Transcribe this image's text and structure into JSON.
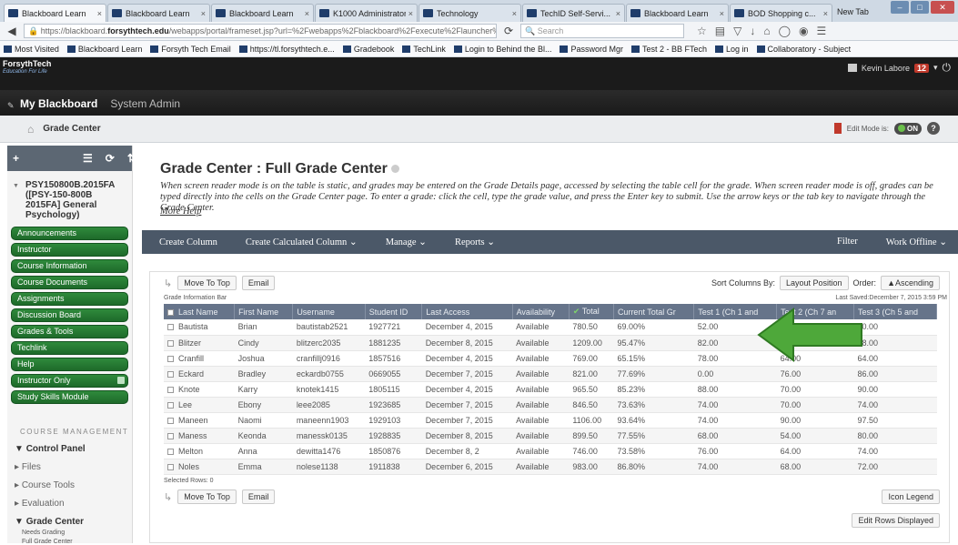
{
  "browser": {
    "tabs": [
      {
        "label": "Blackboard Learn",
        "active": true
      },
      {
        "label": "Blackboard Learn",
        "active": false
      },
      {
        "label": "Blackboard Learn",
        "active": false
      },
      {
        "label": "K1000 Administrator ...",
        "active": false
      },
      {
        "label": "Technology",
        "active": false
      },
      {
        "label": "TechID Self-Servi...",
        "active": false
      },
      {
        "label": "Blackboard Learn",
        "active": false
      },
      {
        "label": "BOD Shopping c...",
        "active": false
      }
    ],
    "new_tab_label": "New Tab",
    "url_prefix": "https://blackboard.",
    "url_host": "forsythtech.edu",
    "url_rest": "/webapps/portal/frameset.jsp?url=%2Fwebapps%2Fblackboard%2Fexecute%2Flauncher%3Ftype%3DCourse%26id%3D_189",
    "search_placeholder": "Search",
    "bookmarks": [
      "Most Visited",
      "Blackboard Learn",
      "Forsyth Tech Email",
      "https://tl.forsythtech.e...",
      "Gradebook",
      "TechLink",
      "Login to Behind the Bl...",
      "Password Mgr",
      "Test 2 - BB FTech",
      "Log in",
      "Collaboratory - Subject"
    ]
  },
  "bb": {
    "logo": "ForsythTech",
    "logo_tag": "Education For Life",
    "user_name": "Kevin Labore",
    "notification_count": "12",
    "tabs": [
      "My Blackboard",
      "System Admin"
    ],
    "breadcrumb": "Grade Center",
    "edit_mode_label": "Edit Mode is:",
    "edit_mode_value": "ON"
  },
  "sidebar": {
    "course_title": "PSY150800B.2015FA ([PSY-150-800B 2015FA] General Psychology)",
    "menu": [
      "Announcements",
      "Instructor",
      "Course Information",
      "Course Documents",
      "Assignments",
      "Discussion Board",
      "Grades & Tools",
      "Techlink",
      "Help",
      "Instructor Only",
      "Study Skills Module"
    ],
    "mgmt_header": "COURSE MANAGEMENT",
    "mgmt_items": [
      "Control Panel",
      "Files",
      "Course Tools",
      "Evaluation",
      "Grade Center"
    ],
    "grade_center_sub": [
      "Needs Grading",
      "Full Grade Center"
    ]
  },
  "main": {
    "title": "Grade Center : Full Grade Center",
    "intro": "When screen reader mode is on the table is static, and grades may be entered on the Grade Details page, accessed by selecting the table cell for the grade. When screen reader mode is off, grades can be typed directly into the cells on the Grade Center page. To enter a grade: click the cell, type the grade value, and press the Enter key to submit. Use the arrow keys or the tab key to navigate through the Grade Center.",
    "more_help": "More Help",
    "actions": [
      "Create Column",
      "Create Calculated Column ⌄",
      "Manage ⌄",
      "Reports ⌄"
    ],
    "actions_right": [
      "Filter",
      "Work Offline ⌄"
    ],
    "move_to_top": "Move To Top",
    "email": "Email",
    "sort_label": "Sort Columns By:",
    "sort_value": "Layout Position",
    "order_label": "Order:",
    "order_value": "▲Ascending",
    "grade_info_bar": "Grade Information Bar",
    "last_saved": "Last Saved:December 7, 2015 3:59 PM",
    "columns": [
      "Last Name",
      "First Name",
      "Username",
      "Student ID",
      "Last Access",
      "Availability",
      "Total",
      "Current Total Gr",
      "Test 1 (Ch 1 and",
      "Test 2 (Ch 7 an",
      "Test 3 (Ch 5 and"
    ],
    "rows": [
      [
        "Bautista",
        "Brian",
        "bautistab2521",
        "1927721",
        "December 4, 2015",
        "Available",
        "780.50",
        "69.00%",
        "52.00",
        "",
        "70.00"
      ],
      [
        "Blitzer",
        "Cindy",
        "blitzerc2035",
        "1881235",
        "December 8, 2015",
        "Available",
        "1209.00",
        "95.47%",
        "82.00",
        "",
        "88.00"
      ],
      [
        "Cranfill",
        "Joshua",
        "cranfillj0916",
        "1857516",
        "December 4, 2015",
        "Available",
        "769.00",
        "65.15%",
        "78.00",
        "64.00",
        "64.00"
      ],
      [
        "Eckard",
        "Bradley",
        "eckardb0755",
        "0669055",
        "December 7, 2015",
        "Available",
        "821.00",
        "77.69%",
        "0.00",
        "76.00",
        "86.00"
      ],
      [
        "Knote",
        "Karry",
        "knotek1415",
        "1805115",
        "December 4, 2015",
        "Available",
        "965.50",
        "85.23%",
        "88.00",
        "70.00",
        "90.00"
      ],
      [
        "Lee",
        "Ebony",
        "leee2085",
        "1923685",
        "December 7, 2015",
        "Available",
        "846.50",
        "73.63%",
        "74.00",
        "70.00",
        "74.00"
      ],
      [
        "Maneen",
        "Naomi",
        "maneenn1903",
        "1929103",
        "December 7, 2015",
        "Available",
        "1106.00",
        "93.64%",
        "74.00",
        "90.00",
        "97.50"
      ],
      [
        "Maness",
        "Keonda",
        "manessk0135",
        "1928835",
        "December 8, 2015",
        "Available",
        "899.50",
        "77.55%",
        "68.00",
        "54.00",
        "80.00"
      ],
      [
        "Melton",
        "Anna",
        "dewitta1476",
        "1850876",
        "December 8, 2",
        "Available",
        "746.00",
        "73.58%",
        "76.00",
        "64.00",
        "74.00"
      ],
      [
        "Noles",
        "Emma",
        "nolese1138",
        "1911838",
        "December 6, 2015",
        "Available",
        "983.00",
        "86.80%",
        "74.00",
        "68.00",
        "72.00"
      ]
    ],
    "selected_rows": "Selected Rows: 0",
    "icon_legend": "Icon Legend",
    "edit_rows": "Edit Rows Displayed"
  },
  "colors": {
    "menu_green": "#2f8a3c",
    "action_bar": "#4b5868",
    "header_dark": "#1b1b1b",
    "arrow_green": "#4ea83a"
  }
}
